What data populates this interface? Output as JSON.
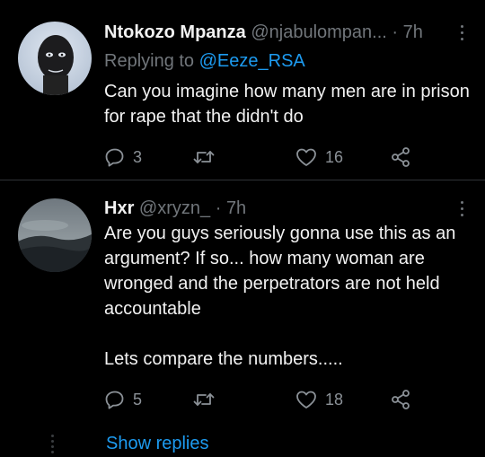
{
  "tweets": [
    {
      "display_name": "Ntokozo Mpanza",
      "handle": "@njabulompan...",
      "separator": "·",
      "time": "7h",
      "replying_prefix": "Replying to",
      "replying_to": "@Eeze_RSA",
      "text": "Can you imagine how many men are in prison for rape that the didn't do",
      "reply_count": "3",
      "retweet_count": "",
      "like_count": "16",
      "avatar": "person-portrait"
    },
    {
      "display_name": "Hxr",
      "handle": "@xryzn_",
      "separator": "·",
      "time": "7h",
      "text": "Are you guys seriously gonna use this as an argument? If so... how many woman are wronged and the perpetrators are not held accountable\n\nLets compare the numbers.....",
      "reply_count": "5",
      "retweet_count": "",
      "like_count": "18",
      "avatar": "misty-landscape"
    }
  ],
  "show_replies_label": "Show replies",
  "colors": {
    "background": "#000000",
    "accent": "#1d9bf0",
    "secondary_text": "#71767b",
    "primary_text": "#f2f2f2"
  },
  "icons": [
    "more-vertical-icon",
    "reply-icon",
    "retweet-icon",
    "like-icon",
    "share-icon"
  ]
}
